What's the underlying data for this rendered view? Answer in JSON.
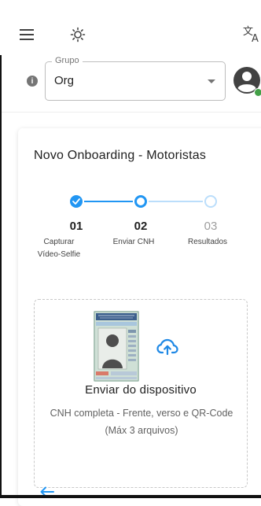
{
  "header": {
    "group": {
      "label": "Grupo",
      "value": "Org"
    },
    "user_status": "online"
  },
  "card": {
    "title": "Novo Onboarding - Motoristas",
    "steps": [
      {
        "number": "01",
        "label_line1": "Capturar",
        "label_line2": "Vídeo-Selfie",
        "status": "completed"
      },
      {
        "number": "02",
        "label_line1": "Enviar CNH",
        "label_line2": "",
        "status": "active"
      },
      {
        "number": "03",
        "label_line1": "Resultados",
        "label_line2": "",
        "status": "pending"
      }
    ],
    "upload": {
      "title": "Enviar do dispositivo",
      "subtitle": "CNH completa - Frente, verso e QR-Code (Máx 3 arquivos)"
    }
  },
  "colors": {
    "accent": "#2196f3",
    "accent_light": "#bbdefb",
    "online": "#43a047"
  },
  "icons": [
    "menu-icon",
    "brightness-icon",
    "translate-icon",
    "info-icon",
    "account-circle-icon",
    "check-icon",
    "cloud-upload-icon",
    "arrow-back-icon"
  ]
}
